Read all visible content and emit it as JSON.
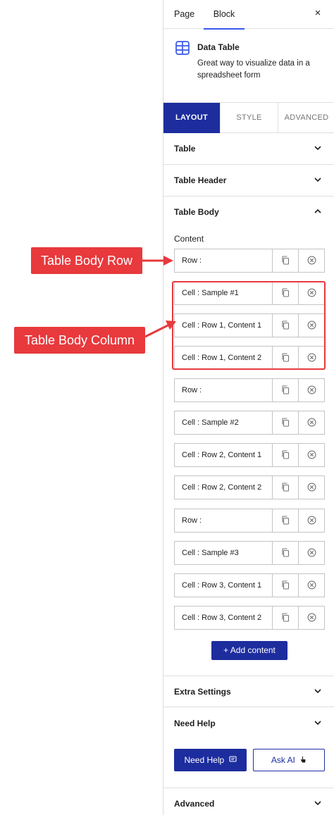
{
  "header": {
    "tab_page": "Page",
    "tab_block": "Block",
    "close_icon": "×"
  },
  "block": {
    "title": "Data Table",
    "description": "Great way to visualize data in a spreadsheet form",
    "icon": "table-icon"
  },
  "tabs": {
    "layout": "LAYOUT",
    "style": "STYLE",
    "advanced": "ADVANCED"
  },
  "sections": {
    "table": "Table",
    "table_header": "Table Header",
    "table_body": "Table Body",
    "extra_settings": "Extra Settings",
    "need_help": "Need Help",
    "advanced": "Advanced"
  },
  "content_label": "Content",
  "rows": [
    "Row :",
    "Cell : Sample #1",
    "Cell : Row 1, Content 1",
    "Cell : Row 1, Content 2",
    "Row :",
    "Cell : Sample #2",
    "Cell : Row 2, Content 1",
    "Cell : Row 2, Content 2",
    "Row :",
    "Cell : Sample #3",
    "Cell : Row 3, Content 1",
    "Cell : Row 3, Content 2"
  ],
  "add_content": "+ Add content",
  "help": {
    "need_help": "Need Help",
    "ask_ai": "Ask AI"
  },
  "annotations": {
    "row_label": "Table Body Row",
    "column_label": "Table Body Column"
  },
  "colors": {
    "primary": "#1d2d9e",
    "accent_tab": "#3858e9",
    "annotation": "#e8393d",
    "border": "#c3c4c7"
  }
}
